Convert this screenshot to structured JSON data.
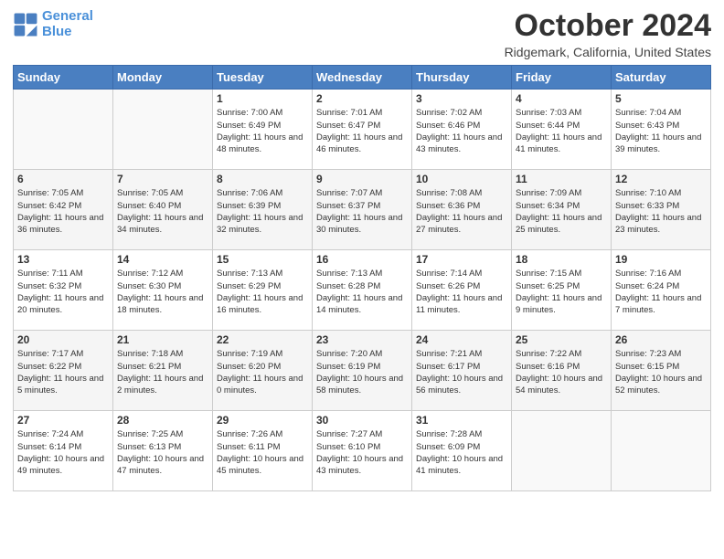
{
  "header": {
    "logo_line1": "General",
    "logo_line2": "Blue",
    "month": "October 2024",
    "location": "Ridgemark, California, United States"
  },
  "weekdays": [
    "Sunday",
    "Monday",
    "Tuesday",
    "Wednesday",
    "Thursday",
    "Friday",
    "Saturday"
  ],
  "weeks": [
    [
      {
        "day": "",
        "info": ""
      },
      {
        "day": "",
        "info": ""
      },
      {
        "day": "1",
        "info": "Sunrise: 7:00 AM\nSunset: 6:49 PM\nDaylight: 11 hours and 48 minutes."
      },
      {
        "day": "2",
        "info": "Sunrise: 7:01 AM\nSunset: 6:47 PM\nDaylight: 11 hours and 46 minutes."
      },
      {
        "day": "3",
        "info": "Sunrise: 7:02 AM\nSunset: 6:46 PM\nDaylight: 11 hours and 43 minutes."
      },
      {
        "day": "4",
        "info": "Sunrise: 7:03 AM\nSunset: 6:44 PM\nDaylight: 11 hours and 41 minutes."
      },
      {
        "day": "5",
        "info": "Sunrise: 7:04 AM\nSunset: 6:43 PM\nDaylight: 11 hours and 39 minutes."
      }
    ],
    [
      {
        "day": "6",
        "info": "Sunrise: 7:05 AM\nSunset: 6:42 PM\nDaylight: 11 hours and 36 minutes."
      },
      {
        "day": "7",
        "info": "Sunrise: 7:05 AM\nSunset: 6:40 PM\nDaylight: 11 hours and 34 minutes."
      },
      {
        "day": "8",
        "info": "Sunrise: 7:06 AM\nSunset: 6:39 PM\nDaylight: 11 hours and 32 minutes."
      },
      {
        "day": "9",
        "info": "Sunrise: 7:07 AM\nSunset: 6:37 PM\nDaylight: 11 hours and 30 minutes."
      },
      {
        "day": "10",
        "info": "Sunrise: 7:08 AM\nSunset: 6:36 PM\nDaylight: 11 hours and 27 minutes."
      },
      {
        "day": "11",
        "info": "Sunrise: 7:09 AM\nSunset: 6:34 PM\nDaylight: 11 hours and 25 minutes."
      },
      {
        "day": "12",
        "info": "Sunrise: 7:10 AM\nSunset: 6:33 PM\nDaylight: 11 hours and 23 minutes."
      }
    ],
    [
      {
        "day": "13",
        "info": "Sunrise: 7:11 AM\nSunset: 6:32 PM\nDaylight: 11 hours and 20 minutes."
      },
      {
        "day": "14",
        "info": "Sunrise: 7:12 AM\nSunset: 6:30 PM\nDaylight: 11 hours and 18 minutes."
      },
      {
        "day": "15",
        "info": "Sunrise: 7:13 AM\nSunset: 6:29 PM\nDaylight: 11 hours and 16 minutes."
      },
      {
        "day": "16",
        "info": "Sunrise: 7:13 AM\nSunset: 6:28 PM\nDaylight: 11 hours and 14 minutes."
      },
      {
        "day": "17",
        "info": "Sunrise: 7:14 AM\nSunset: 6:26 PM\nDaylight: 11 hours and 11 minutes."
      },
      {
        "day": "18",
        "info": "Sunrise: 7:15 AM\nSunset: 6:25 PM\nDaylight: 11 hours and 9 minutes."
      },
      {
        "day": "19",
        "info": "Sunrise: 7:16 AM\nSunset: 6:24 PM\nDaylight: 11 hours and 7 minutes."
      }
    ],
    [
      {
        "day": "20",
        "info": "Sunrise: 7:17 AM\nSunset: 6:22 PM\nDaylight: 11 hours and 5 minutes."
      },
      {
        "day": "21",
        "info": "Sunrise: 7:18 AM\nSunset: 6:21 PM\nDaylight: 11 hours and 2 minutes."
      },
      {
        "day": "22",
        "info": "Sunrise: 7:19 AM\nSunset: 6:20 PM\nDaylight: 11 hours and 0 minutes."
      },
      {
        "day": "23",
        "info": "Sunrise: 7:20 AM\nSunset: 6:19 PM\nDaylight: 10 hours and 58 minutes."
      },
      {
        "day": "24",
        "info": "Sunrise: 7:21 AM\nSunset: 6:17 PM\nDaylight: 10 hours and 56 minutes."
      },
      {
        "day": "25",
        "info": "Sunrise: 7:22 AM\nSunset: 6:16 PM\nDaylight: 10 hours and 54 minutes."
      },
      {
        "day": "26",
        "info": "Sunrise: 7:23 AM\nSunset: 6:15 PM\nDaylight: 10 hours and 52 minutes."
      }
    ],
    [
      {
        "day": "27",
        "info": "Sunrise: 7:24 AM\nSunset: 6:14 PM\nDaylight: 10 hours and 49 minutes."
      },
      {
        "day": "28",
        "info": "Sunrise: 7:25 AM\nSunset: 6:13 PM\nDaylight: 10 hours and 47 minutes."
      },
      {
        "day": "29",
        "info": "Sunrise: 7:26 AM\nSunset: 6:11 PM\nDaylight: 10 hours and 45 minutes."
      },
      {
        "day": "30",
        "info": "Sunrise: 7:27 AM\nSunset: 6:10 PM\nDaylight: 10 hours and 43 minutes."
      },
      {
        "day": "31",
        "info": "Sunrise: 7:28 AM\nSunset: 6:09 PM\nDaylight: 10 hours and 41 minutes."
      },
      {
        "day": "",
        "info": ""
      },
      {
        "day": "",
        "info": ""
      }
    ]
  ]
}
